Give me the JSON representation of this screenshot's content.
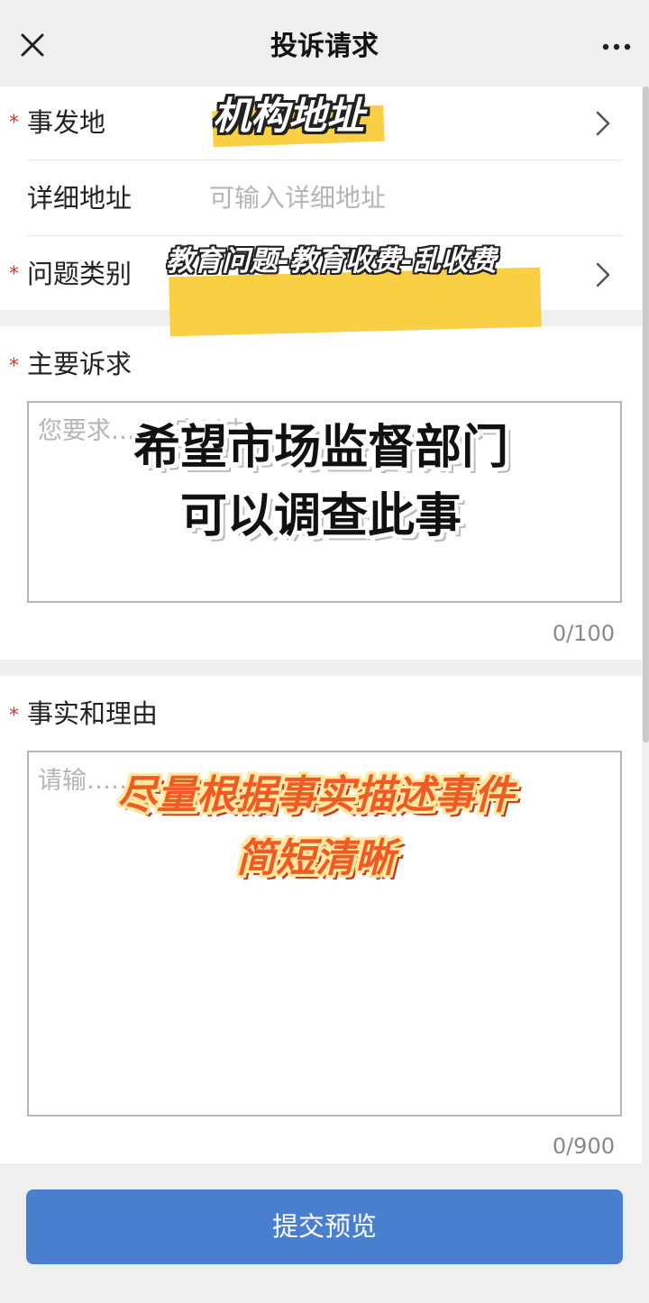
{
  "nav": {
    "title": "投诉请求",
    "close_icon": "close-icon",
    "more_icon": "more-icon"
  },
  "form": {
    "required_mark": "*",
    "location": {
      "label": "事发地"
    },
    "detail_address": {
      "label": "详细地址",
      "placeholder": "可输入详细地址"
    },
    "category": {
      "label": "问题类别"
    },
    "main_request": {
      "label": "主要诉求",
      "placeholder": "您要求……0字以内。",
      "counter": "0/100"
    },
    "facts": {
      "label": "事实和理由",
      "placeholder": "请输……",
      "counter": "0/900"
    },
    "submit_label": "提交预览"
  },
  "overlays": {
    "location_caption": "机构地址",
    "category_caption": "教育问题-教育收费-乱收费",
    "request_caption_line1": "希望市场监督部门",
    "request_caption_line2": "可以调查此事",
    "facts_caption_line1": "尽量根据事实描述事件",
    "facts_caption_line2": "简短清晰"
  },
  "colors": {
    "accent": "#4a7fcf",
    "required": "#d9322c",
    "highlight": "#f9cf44"
  }
}
